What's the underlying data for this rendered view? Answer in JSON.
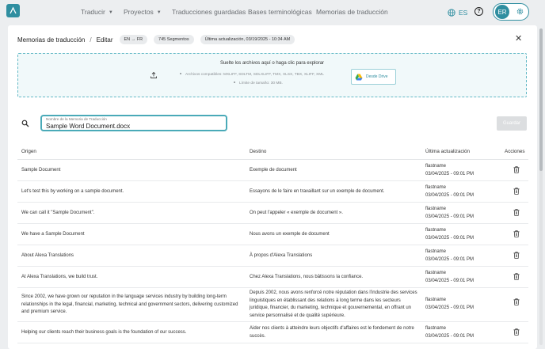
{
  "nav": {
    "items": [
      {
        "label": "Traducir",
        "has_menu": true
      },
      {
        "label": "Proyectos",
        "has_menu": true
      },
      {
        "label": "Traducciones guardadas",
        "has_menu": false
      },
      {
        "label": "Bases terminológicas",
        "has_menu": false
      },
      {
        "label": "Memorias de traducción",
        "has_menu": false
      }
    ],
    "language": "ES",
    "user_initials": "ER"
  },
  "header": {
    "breadcrumb_parent": "Memorias de traducción",
    "breadcrumb_separator": "/",
    "breadcrumb_current": "Editar",
    "language_pair_chip": "EN → FR",
    "segments_chip": "745 Segmentos",
    "last_updated_chip": "Última actualización, 03/19/2025 - 10:34 AM"
  },
  "dropzone": {
    "title": "Suelte los archivos aquí o haga clic para explorar",
    "formats_line": "Archivos compatibles: MXLIFF, SDLTM, SDLXLIFF, TMX, XLSX, TBX, XLIFF, XML",
    "size_line": "Límite de tamaño: 30 MB.",
    "drive_button": "Desde Drive"
  },
  "name_field": {
    "label": "Nombre de la Memoria de Traducción",
    "value": "Sample Word Document.docx"
  },
  "save_button": "Guardar",
  "table": {
    "headers": {
      "source": "Origen",
      "target": "Destino",
      "updated": "Última actualización",
      "actions": "Acciones"
    },
    "rows": [
      {
        "source": "Sample Document",
        "target": "Exemple de document",
        "user": "flastname",
        "date": "03/04/2025 - 09:01 PM"
      },
      {
        "source": "Let's test this by working on a sample document.",
        "target": "Essayons de le faire en travaillant sur un exemple de document.",
        "user": "flastname",
        "date": "03/04/2025 - 09:01 PM"
      },
      {
        "source": "We can call it \"Sample Document\".",
        "target": "On peut l'appeler « exemple de document ».",
        "user": "flastname",
        "date": "03/04/2025 - 09:01 PM"
      },
      {
        "source": "We have a Sample Document",
        "target": "Nous avons un exemple de document",
        "user": "flastname",
        "date": "03/04/2025 - 09:01 PM"
      },
      {
        "source": "About Alexa Translations",
        "target": "À propos d'Alexa Translations",
        "user": "flastname",
        "date": "03/04/2025 - 09:01 PM"
      },
      {
        "source": "At Alexa Translations, we build trust.",
        "target": "Chez Alexa Translations, nous bâtissons la confiance.",
        "user": "flastname",
        "date": "03/04/2025 - 09:01 PM"
      },
      {
        "source": "Since 2002, we have grown our reputation in the language services industry by building long-term relationships in the legal, financial, marketing, technical and government sectors, delivering customized and premium service.",
        "target": "Depuis 2002, nous avons renforcé notre réputation dans l'industrie des services linguistiques en établissant des relations à long terme dans les secteurs juridique, financier, du marketing, technique et gouvernemental, en offrant un service personnalisé et de qualité supérieure.",
        "user": "flastname",
        "date": "03/04/2025 - 09:01 PM"
      },
      {
        "source": "Helping our clients reach their business goals is the foundation of our success.",
        "target": "Aider nos clients à atteindre leurs objectifs d'affaires est le fondement de notre succès.",
        "user": "flastname",
        "date": "03/04/2025 - 09:01 PM"
      }
    ]
  },
  "colors": {
    "accent": "#2f8ea0",
    "background": "#eceef0",
    "panel": "#ffffff"
  }
}
